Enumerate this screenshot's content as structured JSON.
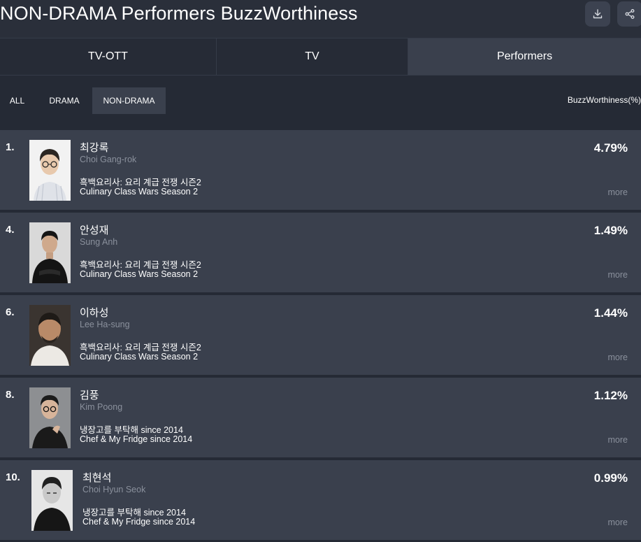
{
  "header": {
    "title": "NON-DRAMA Performers BuzzWorthiness",
    "download_icon": "download-icon",
    "share_icon": "share-icon"
  },
  "tabs": [
    {
      "label": "TV-OTT"
    },
    {
      "label": "TV"
    },
    {
      "label": "Performers"
    }
  ],
  "active_tab": "Performers",
  "filters": [
    {
      "label": "ALL"
    },
    {
      "label": "DRAMA"
    },
    {
      "label": "NON-DRAMA"
    }
  ],
  "active_filter": "NON-DRAMA",
  "metric_label": "BuzzWorthiness(%)",
  "more_label": "more",
  "performers": [
    {
      "rank": "1.",
      "name": "최강록",
      "name_en": "Choi Gang-rok",
      "show_ko": "흑백요리사: 요리 계급 전쟁 시즌2",
      "show_en": "Culinary Class Wars Season 2",
      "buzz": "4.79%"
    },
    {
      "rank": "4.",
      "name": "안성재",
      "name_en": "Sung Anh",
      "show_ko": "흑백요리사: 요리 계급 전쟁 시즌2",
      "show_en": "Culinary Class Wars Season 2",
      "buzz": "1.49%"
    },
    {
      "rank": "6.",
      "name": "이하성",
      "name_en": "Lee Ha-sung",
      "show_ko": "흑백요리사: 요리 계급 전쟁 시즌2",
      "show_en": "Culinary Class Wars Season 2",
      "buzz": "1.44%"
    },
    {
      "rank": "8.",
      "name": "김풍",
      "name_en": "Kim Poong",
      "show_ko": "냉장고를 부탁해 since 2014",
      "show_en": "Chef & My Fridge since 2014",
      "buzz": "1.12%"
    },
    {
      "rank": "10.",
      "name": "최현석",
      "name_en": "Choi Hyun Seok",
      "show_ko": "냉장고를 부탁해 since 2014",
      "show_en": "Chef & My Fridge since 2014",
      "buzz": "0.99%"
    }
  ],
  "colors": {
    "background": "#252a35",
    "row": "#3a404d",
    "active": "#3a404d",
    "muted_text": "#8a909c"
  }
}
